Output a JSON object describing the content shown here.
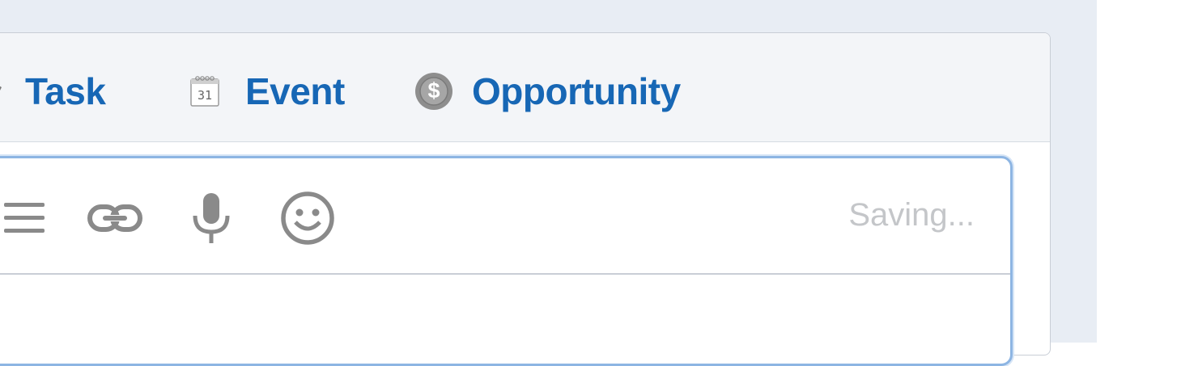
{
  "tabs": [
    {
      "label": "Task",
      "icon": "pencil-icon"
    },
    {
      "label": "Event",
      "icon": "calendar-icon",
      "icon_text": "31"
    },
    {
      "label": "Opportunity",
      "icon": "dollar-coin-icon",
      "icon_text": "$"
    }
  ],
  "composer": {
    "toolbar": {
      "tools": [
        "list-icon",
        "link-icon",
        "microphone-icon",
        "emoji-icon"
      ],
      "status": "Saving..."
    }
  },
  "colors": {
    "accent": "#1767b5",
    "page_background": "#e8edf4",
    "tabbar_background": "#f3f5f8",
    "composer_border": "#8db5e3",
    "icon_gray": "#8a8a8a",
    "status_gray": "#c4c6c9"
  }
}
